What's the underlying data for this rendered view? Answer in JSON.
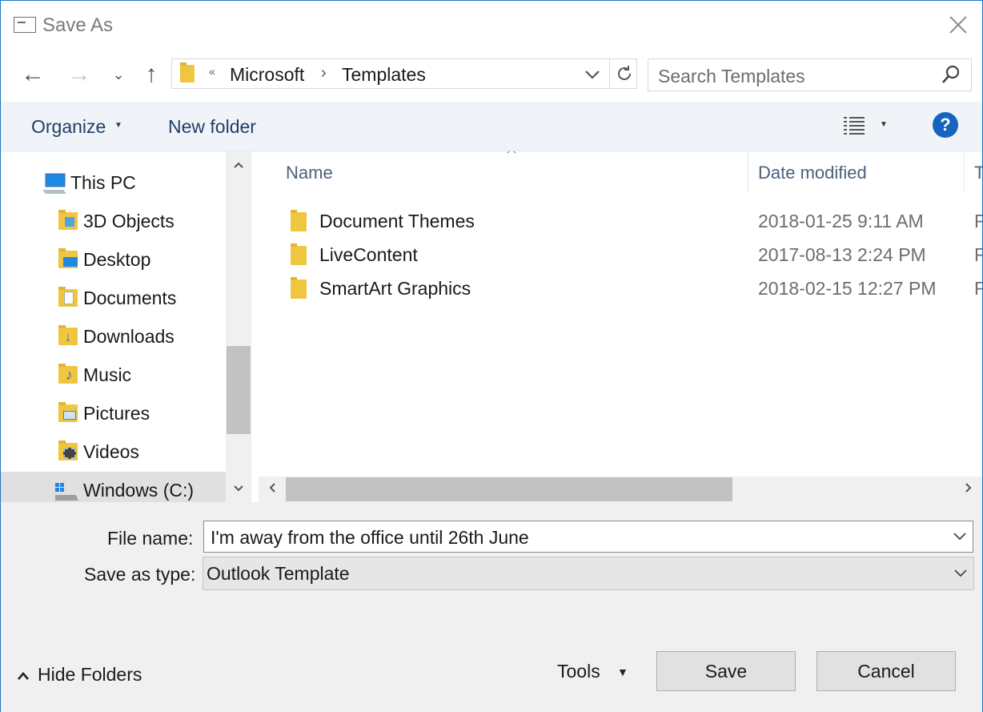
{
  "window": {
    "title": "Save As"
  },
  "nav": {
    "breadcrumb": [
      "Microsoft",
      "Templates"
    ],
    "overflow_chevron": "«"
  },
  "search": {
    "placeholder": "Search Templates"
  },
  "toolbar": {
    "organize_label": "Organize",
    "new_folder_label": "New folder",
    "help_label": "?"
  },
  "tree": {
    "items": [
      {
        "label": "This PC",
        "icon": "computer-icon"
      },
      {
        "label": "3D Objects",
        "icon": "3d-objects-folder-icon"
      },
      {
        "label": "Desktop",
        "icon": "desktop-folder-icon"
      },
      {
        "label": "Documents",
        "icon": "documents-folder-icon"
      },
      {
        "label": "Downloads",
        "icon": "downloads-folder-icon"
      },
      {
        "label": "Music",
        "icon": "music-folder-icon"
      },
      {
        "label": "Pictures",
        "icon": "pictures-folder-icon"
      },
      {
        "label": "Videos",
        "icon": "videos-folder-icon"
      },
      {
        "label": "Windows (C:)",
        "icon": "drive-icon",
        "selected": true
      }
    ]
  },
  "columns": {
    "name": "Name",
    "date": "Date modified",
    "type": "T"
  },
  "files": [
    {
      "name": "Document Themes",
      "date": "2018-01-25 9:11 AM",
      "type": "F"
    },
    {
      "name": "LiveContent",
      "date": "2017-08-13 2:24 PM",
      "type": "F"
    },
    {
      "name": "SmartArt Graphics",
      "date": "2018-02-15 12:27 PM",
      "type": "F"
    }
  ],
  "form": {
    "file_name_label": "File name:",
    "file_name_value": "I'm away from the office until 26th June",
    "save_type_label": "Save as type:",
    "save_type_value": "Outlook Template"
  },
  "footer": {
    "hide_folders_label": "Hide Folders",
    "tools_label": "Tools",
    "save_label": "Save",
    "cancel_label": "Cancel"
  },
  "colors": {
    "accent": "#1c78c8",
    "help": "#1565c0",
    "folder": "#f0c640",
    "toolbar_bg": "#f0f4f9"
  }
}
